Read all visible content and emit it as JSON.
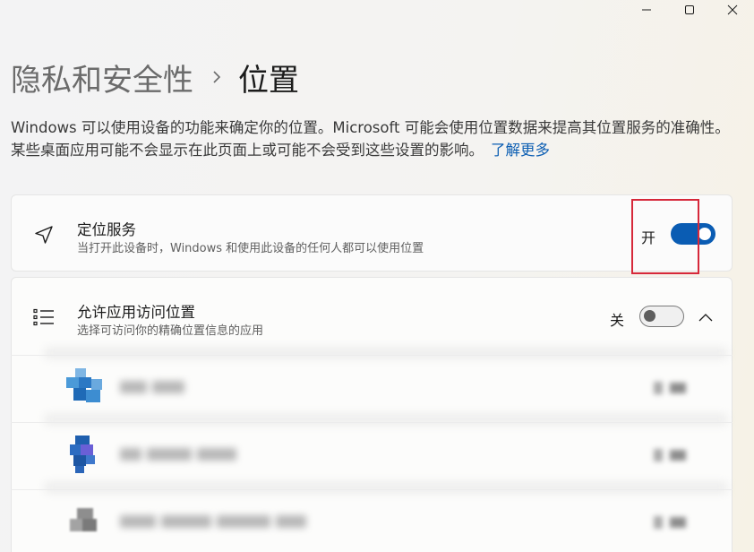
{
  "window": {
    "controls": [
      "minimize",
      "maximize",
      "close"
    ]
  },
  "header": {
    "parent": "隐私和安全性",
    "separator": "›",
    "current": "位置"
  },
  "description": {
    "text": "Windows 可以使用设备的功能来确定你的位置。Microsoft 可能会使用位置数据来提高其位置服务的准确性。 某些桌面应用可能不会显示在此页面上或可能不会受到这些设置的影响。",
    "link": "了解更多"
  },
  "location_service": {
    "icon": "navigation-arrow-icon",
    "title": "定位服务",
    "subtitle": "当打开此设备时，Windows 和使用此设备的任何人都可以使用位置",
    "state_label": "开",
    "enabled": true,
    "highlighted": true,
    "highlight_color": "#d6283a"
  },
  "app_access": {
    "icon": "list-icon",
    "title": "允许应用访问位置",
    "subtitle": "选择可访问你的精确位置信息的应用",
    "state_label": "关",
    "enabled": false,
    "expanded": true
  },
  "apps": [
    {
      "icon": "blurred-app-icon-1",
      "name_redacted": true
    },
    {
      "icon": "blurred-app-icon-2",
      "name_redacted": true
    },
    {
      "icon": "blurred-app-icon-3",
      "name_redacted": true
    }
  ],
  "colors": {
    "accent": "#0a5cb3",
    "link": "#0d5fb3"
  }
}
